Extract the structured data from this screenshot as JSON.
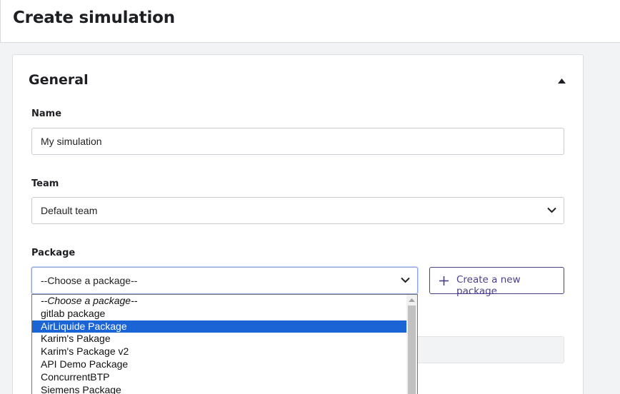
{
  "header": {
    "title": "Create simulation"
  },
  "general": {
    "title": "General",
    "collapse_icon": "caret-up-icon"
  },
  "name_field": {
    "label": "Name",
    "value": "My simulation"
  },
  "team_field": {
    "label": "Team",
    "value": "Default team"
  },
  "package_field": {
    "label": "Package",
    "value": "--Choose a package--",
    "create_button_label": "Create a new package",
    "options": [
      "--Choose a package--",
      "gitlab package",
      "AirLiquide Package",
      "Karim's Pakage",
      "Karim's Package v2",
      "API Demo Package",
      "ConcurrentBTP",
      "Siemens Package"
    ],
    "highlighted_option": "AirLiquide Package"
  },
  "colors": {
    "accent": "#4a3f8c",
    "highlight": "#1a64d6",
    "background": "#f2f3f5"
  }
}
